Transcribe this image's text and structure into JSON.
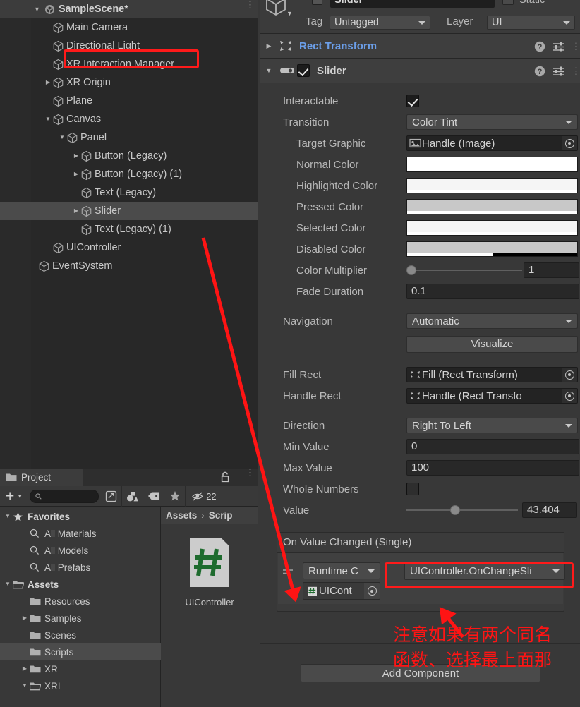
{
  "hierarchy": {
    "scene_name": "SampleScene*",
    "scene_icon": "unity-logo-icon",
    "menu_icon": "kebab-menu-icon",
    "items": [
      {
        "label": "Main Camera",
        "indent": 2,
        "arrow": "none",
        "selected": false
      },
      {
        "label": "Directional Light",
        "indent": 2,
        "arrow": "none",
        "selected": false
      },
      {
        "label": "XR Interaction Manager",
        "indent": 2,
        "arrow": "none",
        "selected": false
      },
      {
        "label": "XR Origin",
        "indent": 2,
        "arrow": "collapsed",
        "selected": false
      },
      {
        "label": "Plane",
        "indent": 2,
        "arrow": "none",
        "selected": false
      },
      {
        "label": "Canvas",
        "indent": 2,
        "arrow": "expanded",
        "selected": false
      },
      {
        "label": "Panel",
        "indent": 3,
        "arrow": "expanded",
        "selected": false
      },
      {
        "label": "Button (Legacy)",
        "indent": 4,
        "arrow": "collapsed",
        "selected": false
      },
      {
        "label": "Button (Legacy) (1)",
        "indent": 4,
        "arrow": "collapsed",
        "selected": false
      },
      {
        "label": "Text (Legacy)",
        "indent": 4,
        "arrow": "none",
        "selected": false
      },
      {
        "label": "Slider",
        "indent": 4,
        "arrow": "collapsed",
        "selected": true
      },
      {
        "label": "Text (Legacy) (1)",
        "indent": 4,
        "arrow": "none",
        "selected": false
      },
      {
        "label": "UIController",
        "indent": 2,
        "arrow": "none",
        "selected": false
      },
      {
        "label": "EventSystem",
        "indent": 1,
        "arrow": "none",
        "selected": false
      }
    ]
  },
  "project": {
    "tab_label": "Project",
    "tab_icon": "folder-icon",
    "lock_icon": "lock-icon",
    "menu_icon": "kebab-menu-icon",
    "toolbar": {
      "add_label": "+",
      "search_placeholder": "",
      "search_value": "",
      "search_icon": "magnifier-icon",
      "save_search_icon": "save-search-icon",
      "filter_type_icon": "filter-by-type-icon",
      "filter_label_icon": "filter-by-label-icon",
      "filter_favorite_icon": "star-icon",
      "hidden_icon": "eye-off-icon",
      "hidden_count": "22"
    },
    "tree": [
      {
        "label": "Favorites",
        "indent": 0,
        "arrow": "expanded",
        "icon": "star-icon",
        "bold": true,
        "selected": false
      },
      {
        "label": "All Materials",
        "indent": 1,
        "arrow": "none",
        "icon": "magnifier-icon",
        "bold": false,
        "selected": false
      },
      {
        "label": "All Models",
        "indent": 1,
        "arrow": "none",
        "icon": "magnifier-icon",
        "bold": false,
        "selected": false
      },
      {
        "label": "All Prefabs",
        "indent": 1,
        "arrow": "none",
        "icon": "magnifier-icon",
        "bold": false,
        "selected": false
      },
      {
        "label": "Assets",
        "indent": 0,
        "arrow": "expanded",
        "icon": "folder-open-icon",
        "bold": true,
        "selected": false
      },
      {
        "label": "Resources",
        "indent": 1,
        "arrow": "none",
        "icon": "folder-icon",
        "bold": false,
        "selected": false
      },
      {
        "label": "Samples",
        "indent": 1,
        "arrow": "collapsed",
        "icon": "folder-icon",
        "bold": false,
        "selected": false
      },
      {
        "label": "Scenes",
        "indent": 1,
        "arrow": "none",
        "icon": "folder-icon",
        "bold": false,
        "selected": false
      },
      {
        "label": "Scripts",
        "indent": 1,
        "arrow": "none",
        "icon": "folder-icon",
        "bold": false,
        "selected": true
      },
      {
        "label": "XR",
        "indent": 1,
        "arrow": "collapsed",
        "icon": "folder-icon",
        "bold": false,
        "selected": false
      },
      {
        "label": "XRI",
        "indent": 1,
        "arrow": "expanded",
        "icon": "folder-open-icon",
        "bold": false,
        "selected": false
      }
    ],
    "breadcrumb": {
      "root": "Assets",
      "separator": "›",
      "current": "Scrip"
    },
    "assets": [
      {
        "label": "UIController",
        "icon": "csharp-script-icon"
      }
    ]
  },
  "inspector": {
    "gameobject": {
      "name": "Slider",
      "enabled_checkbox": true,
      "static_label": "Static",
      "static_checked": false,
      "tag_label": "Tag",
      "tag_value": "Untagged",
      "layer_label": "Layer",
      "layer_value": "UI",
      "icon": "gameobject-cube-icon"
    },
    "components": [
      {
        "title": "Rect Transform",
        "expanded": false,
        "icon": "rect-transform-icon",
        "help_icon": "help-icon",
        "preset_icon": "preset-icon",
        "menu_icon": "kebab-menu-icon"
      },
      {
        "title": "Slider",
        "expanded": true,
        "icon": "slider-component-icon",
        "enabled": true,
        "help_icon": "help-icon",
        "preset_icon": "preset-icon",
        "menu_icon": "kebab-menu-icon"
      }
    ],
    "slider_fields": {
      "interactable": {
        "label": "Interactable",
        "checked": true
      },
      "transition": {
        "label": "Transition",
        "value": "Color Tint"
      },
      "target_graphic": {
        "label": "Target Graphic",
        "value": "Handle (Image)",
        "icon": "image-component-icon"
      },
      "normal_color": {
        "label": "Normal Color",
        "hex": "#FFFFFF",
        "alpha": 1.0
      },
      "highlighted_color": {
        "label": "Highlighted Color",
        "hex": "#F5F5F5",
        "alpha": 1.0
      },
      "pressed_color": {
        "label": "Pressed Color",
        "hex": "#C8C8C8",
        "alpha": 1.0
      },
      "selected_color": {
        "label": "Selected Color",
        "hex": "#F5F5F5",
        "alpha": 1.0
      },
      "disabled_color": {
        "label": "Disabled Color",
        "hex": "#C8C8C8",
        "alpha": 0.5
      },
      "color_multiplier": {
        "label": "Color Multiplier",
        "value": "1",
        "slider_pct": 0
      },
      "fade_duration": {
        "label": "Fade Duration",
        "value": "0.1"
      },
      "navigation": {
        "label": "Navigation",
        "value": "Automatic"
      },
      "visualize_button": {
        "label": "Visualize"
      },
      "fill_rect": {
        "label": "Fill Rect",
        "value": "Fill (Rect Transform)",
        "icon": "rect-transform-icon"
      },
      "handle_rect": {
        "label": "Handle Rect",
        "value": "Handle (Rect Transfo",
        "icon": "rect-transform-icon"
      },
      "direction": {
        "label": "Direction",
        "value": "Right To Left"
      },
      "min_value": {
        "label": "Min Value",
        "value": "0"
      },
      "max_value": {
        "label": "Max Value",
        "value": "100"
      },
      "whole_numbers": {
        "label": "Whole Numbers",
        "checked": false
      },
      "value": {
        "label": "Value",
        "value": "43.404",
        "slider_pct": 43.4
      }
    },
    "event_section": {
      "title": "On Value Changed (Single)",
      "row": {
        "drag_handle_icon": "drag-handle-icon",
        "runtime_mode": "Runtime C",
        "object_value": "UICont",
        "object_icon": "csharp-script-icon",
        "function_value": "UIController.OnChangeSli"
      }
    },
    "add_component_button": {
      "label": "Add Component"
    }
  },
  "annotations": {
    "accent_color": "#FF1414",
    "note_line1": "注意如果有两个同名",
    "note_line2": "函数、选择最上面那",
    "highlight_hierarchy_target": "UIController",
    "highlight_function_target": "UIController.OnChangeSli"
  }
}
